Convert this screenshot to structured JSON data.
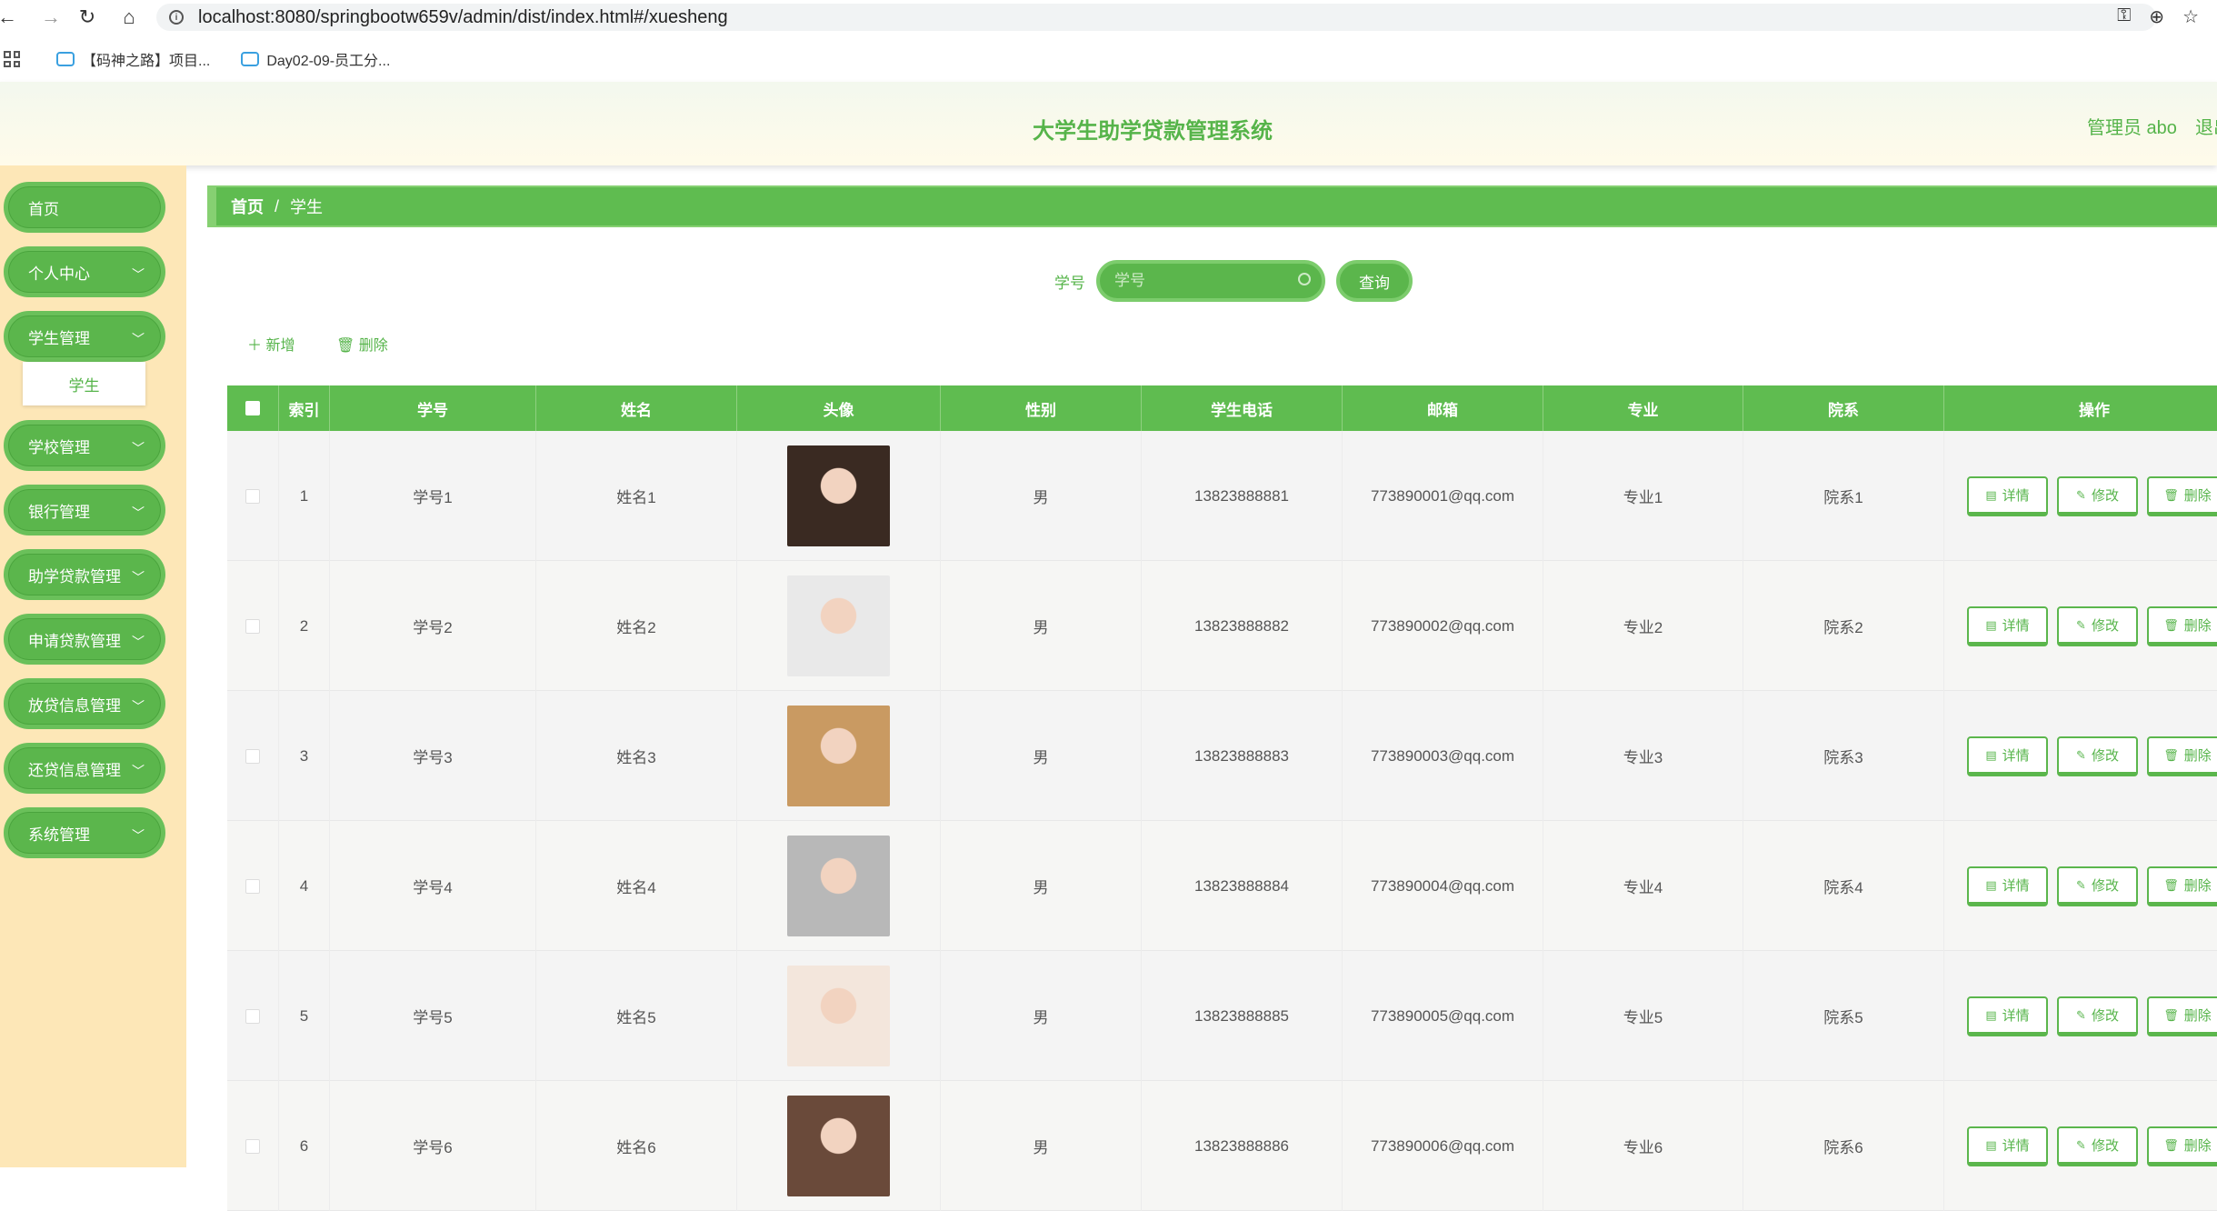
{
  "browser": {
    "url": "localhost:8080/springbootw659v/admin/dist/index.html#/xuesheng",
    "bookmarks": [
      "【码神之路】项目...",
      "Day02-09-员工分..."
    ]
  },
  "header": {
    "title": "大学生助学贷款管理系统",
    "admin": "管理员 abo",
    "logout": "退出"
  },
  "sidebar": {
    "items": [
      {
        "label": "首页",
        "chevron": false
      },
      {
        "label": "个人中心",
        "chevron": true
      },
      {
        "label": "学生管理",
        "chevron": true
      },
      {
        "label": "学校管理",
        "chevron": true
      },
      {
        "label": "银行管理",
        "chevron": true
      },
      {
        "label": "助学贷款管理",
        "chevron": true
      },
      {
        "label": "申请贷款管理",
        "chevron": true
      },
      {
        "label": "放贷信息管理",
        "chevron": true
      },
      {
        "label": "还贷信息管理",
        "chevron": true
      },
      {
        "label": "系统管理",
        "chevron": true
      }
    ],
    "submenu_active": "学生"
  },
  "breadcrumb": {
    "home": "首页",
    "sep": "/",
    "current": "学生"
  },
  "search": {
    "label": "学号",
    "placeholder": "学号",
    "button": "查询"
  },
  "actions": {
    "add": "新增",
    "delete": "删除"
  },
  "table": {
    "headers": [
      "索引",
      "学号",
      "姓名",
      "头像",
      "性别",
      "学生电话",
      "邮箱",
      "专业",
      "院系",
      "操作"
    ],
    "op_labels": {
      "detail": "详情",
      "edit": "修改",
      "delete": "删除"
    },
    "rows": [
      {
        "index": "1",
        "id": "学号1",
        "name": "姓名1",
        "gender": "男",
        "phone": "13823888881",
        "email": "773890001@qq.com",
        "major": "专业1",
        "dept": "院系1",
        "avatar_color": "#3a2a22"
      },
      {
        "index": "2",
        "id": "学号2",
        "name": "姓名2",
        "gender": "男",
        "phone": "13823888882",
        "email": "773890002@qq.com",
        "major": "专业2",
        "dept": "院系2",
        "avatar_color": "#e9e9e9"
      },
      {
        "index": "3",
        "id": "学号3",
        "name": "姓名3",
        "gender": "男",
        "phone": "13823888883",
        "email": "773890003@qq.com",
        "major": "专业3",
        "dept": "院系3",
        "avatar_color": "#c99a62"
      },
      {
        "index": "4",
        "id": "学号4",
        "name": "姓名4",
        "gender": "男",
        "phone": "13823888884",
        "email": "773890004@qq.com",
        "major": "专业4",
        "dept": "院系4",
        "avatar_color": "#b8b8b8"
      },
      {
        "index": "5",
        "id": "学号5",
        "name": "姓名5",
        "gender": "男",
        "phone": "13823888885",
        "email": "773890005@qq.com",
        "major": "专业5",
        "dept": "院系5",
        "avatar_color": "#f3e6dc"
      },
      {
        "index": "6",
        "id": "学号6",
        "name": "姓名6",
        "gender": "男",
        "phone": "13823888886",
        "email": "773890006@qq.com",
        "major": "专业6",
        "dept": "院系6",
        "avatar_color": "#6a4a3a"
      }
    ]
  },
  "colors": {
    "primary": "#5bb64c",
    "sidebar_bg": "#fde7b7"
  }
}
